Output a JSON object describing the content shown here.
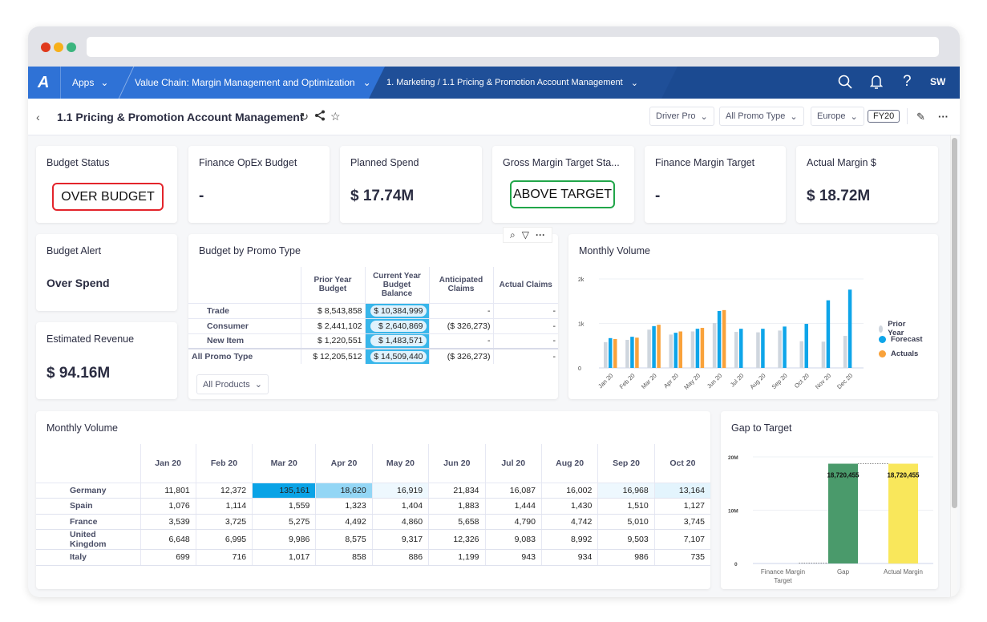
{
  "browser": {
    "dots": [
      "#e0391c",
      "#f7b01a",
      "#3bb57e"
    ]
  },
  "nav": {
    "apps_label": "Apps",
    "breadcrumb_1": "Value Chain: Margin Management and Optimization",
    "breadcrumb_2": "1. Marketing / 1.1 Pricing & Promotion Account Management",
    "user_initials": "SW",
    "icons": [
      "search-icon",
      "bell-icon",
      "help-icon"
    ]
  },
  "page": {
    "title": "1.1 Pricing & Promotion Account Management",
    "filters": [
      {
        "label": "Driver Pro"
      },
      {
        "label": "All Promo Type"
      },
      {
        "label": "Europe"
      }
    ],
    "fiscal_year": "FY20"
  },
  "kpis": {
    "budget_status": {
      "title": "Budget Status",
      "value": "OVER BUDGET",
      "color": "#e3242b"
    },
    "finance_opex": {
      "title": "Finance OpEx Budget",
      "value": "-"
    },
    "planned_spend": {
      "title": "Planned Spend",
      "value": "$ 17.74M"
    },
    "gross_margin_status": {
      "title": "Gross Margin Target Sta...",
      "value": "ABOVE TARGET",
      "color": "#21a649"
    },
    "finance_margin_target": {
      "title": "Finance Margin Target",
      "value": "-"
    },
    "actual_margin": {
      "title": "Actual Margin $",
      "value": "$ 18.72M"
    },
    "budget_alert": {
      "title": "Budget Alert",
      "value": "Over Spend"
    },
    "estimated_revenue": {
      "title": "Estimated Revenue",
      "value": "$ 94.16M"
    }
  },
  "budget_by_promo": {
    "title": "Budget by Promo Type",
    "columns": [
      "Prior Year Budget",
      "Current Year Budget Balance",
      "Anticipated Claims",
      "Actual Claims"
    ],
    "rows": [
      {
        "label": "Trade",
        "cells": [
          "$ 8,543,858",
          "$ 10,384,999",
          "-",
          "-"
        ]
      },
      {
        "label": "Consumer",
        "cells": [
          "$ 2,441,102",
          "$ 2,640,869",
          "($ 326,273)",
          "-"
        ]
      },
      {
        "label": "New Item",
        "cells": [
          "$ 1,220,551",
          "$ 1,483,571",
          "-",
          "-"
        ]
      },
      {
        "label": "All Promo Type",
        "cells": [
          "$ 12,205,512",
          "$ 14,509,440",
          "($ 326,273)",
          "-"
        ]
      }
    ],
    "product_filter": "All Products"
  },
  "chart_data": [
    {
      "type": "bar",
      "title": "Monthly Volume",
      "categories": [
        "Jan 20",
        "Feb 20",
        "Mar 20",
        "Apr 20",
        "May 20",
        "Jun 20",
        "Jul 20",
        "Aug 20",
        "Sep 20",
        "Oct 20",
        "Nov 20",
        "Dec 20"
      ],
      "series": [
        {
          "name": "Prior Year",
          "color": "#cfd6de",
          "values": [
            580,
            630,
            860,
            750,
            820,
            1010,
            810,
            800,
            840,
            600,
            590,
            720
          ]
        },
        {
          "name": "Forecast",
          "color": "#0ea5e9",
          "values": [
            670,
            700,
            940,
            790,
            880,
            1280,
            880,
            880,
            930,
            990,
            1520,
            1760
          ]
        },
        {
          "name": "Actuals",
          "color": "#f9a23b",
          "values": [
            650,
            680,
            970,
            820,
            900,
            1300,
            null,
            null,
            null,
            null,
            null,
            null
          ]
        }
      ],
      "ylim": [
        0,
        2000
      ],
      "yticks": [
        "0",
        "1k",
        "2k"
      ],
      "legend": "right",
      "grid": true
    },
    {
      "type": "bar",
      "title": "Gap to Target",
      "categories": [
        "Finance Margin Target",
        "Gap",
        "Actual Margin"
      ],
      "values": [
        0,
        18720455,
        18720455
      ],
      "data_labels": [
        "",
        "18,720,455",
        "18,720,455"
      ],
      "colors": [
        "#cccccc",
        "#4a9a6b",
        "#f9e75b"
      ],
      "ylim": [
        0,
        20000000
      ],
      "yticks": [
        "0",
        "10M",
        "20M"
      ],
      "grid": true
    }
  ],
  "monthly_table": {
    "title": "Monthly Volume",
    "columns": [
      "Jan 20",
      "Feb 20",
      "Mar 20",
      "Apr 20",
      "May 20",
      "Jun 20",
      "Jul 20",
      "Aug 20",
      "Sep 20",
      "Oct 20"
    ],
    "rows": [
      {
        "label": "Germany",
        "cells": [
          "11,801",
          "12,372",
          "135,161",
          "18,620",
          "16,919",
          "21,834",
          "16,087",
          "16,002",
          "16,968",
          "13,164"
        ]
      },
      {
        "label": "Spain",
        "cells": [
          "1,076",
          "1,114",
          "1,559",
          "1,323",
          "1,404",
          "1,883",
          "1,444",
          "1,430",
          "1,510",
          "1,127"
        ]
      },
      {
        "label": "France",
        "cells": [
          "3,539",
          "3,725",
          "5,275",
          "4,492",
          "4,860",
          "5,658",
          "4,790",
          "4,742",
          "5,010",
          "3,745"
        ]
      },
      {
        "label": "United Kingdom",
        "cells": [
          "6,648",
          "6,995",
          "9,986",
          "8,575",
          "9,317",
          "12,326",
          "9,083",
          "8,992",
          "9,503",
          "7,107"
        ]
      },
      {
        "label": "Italy",
        "cells": [
          "699",
          "716",
          "1,017",
          "858",
          "886",
          "1,199",
          "943",
          "934",
          "986",
          "735"
        ]
      }
    ],
    "heat": {
      "Germany": [
        "#ffffff",
        "#ffffff",
        "#0aa3e6",
        "#93d6f5",
        "#eef8fe",
        "#ffffff",
        "#ffffff",
        "#ffffff",
        "#eef8fe",
        "#e3f4fd"
      ]
    }
  }
}
